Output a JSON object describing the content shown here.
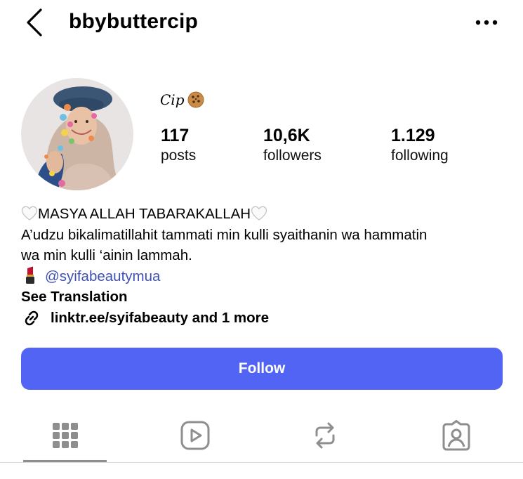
{
  "header": {
    "username": "bbybuttercip",
    "back_icon": "chevron-left-icon",
    "more_icon": "more-horizontal-icon"
  },
  "profile": {
    "display_name": "Cip",
    "name_emoji": "cookie-icon",
    "stats": [
      {
        "value": "117",
        "label": "posts"
      },
      {
        "value": "10,6K",
        "label": "followers"
      },
      {
        "value": "1.129",
        "label": "following"
      }
    ]
  },
  "bio": {
    "line1": "MASYA ALLAH TABARAKALLAH",
    "line2": "A’udzu bikalimatillahit tammati min kulli syaithanin wa hammatin",
    "line3": "wa min kulli ‘ainin lammah.",
    "mention": "@syifabeautymua",
    "see_translation": "See Translation",
    "link": "linktr.ee/syifabeauty and 1 more"
  },
  "actions": {
    "follow_label": "Follow"
  },
  "tabs": [
    {
      "name": "grid",
      "icon": "grid-icon",
      "active": true
    },
    {
      "name": "reels",
      "icon": "reels-icon",
      "active": false
    },
    {
      "name": "reposts",
      "icon": "repost-icon",
      "active": false
    },
    {
      "name": "tagged",
      "icon": "tagged-icon",
      "active": false
    }
  ],
  "colors": {
    "accent": "#5264f3",
    "mention": "#3f51b5",
    "icon_gray": "#8e8e8e"
  }
}
